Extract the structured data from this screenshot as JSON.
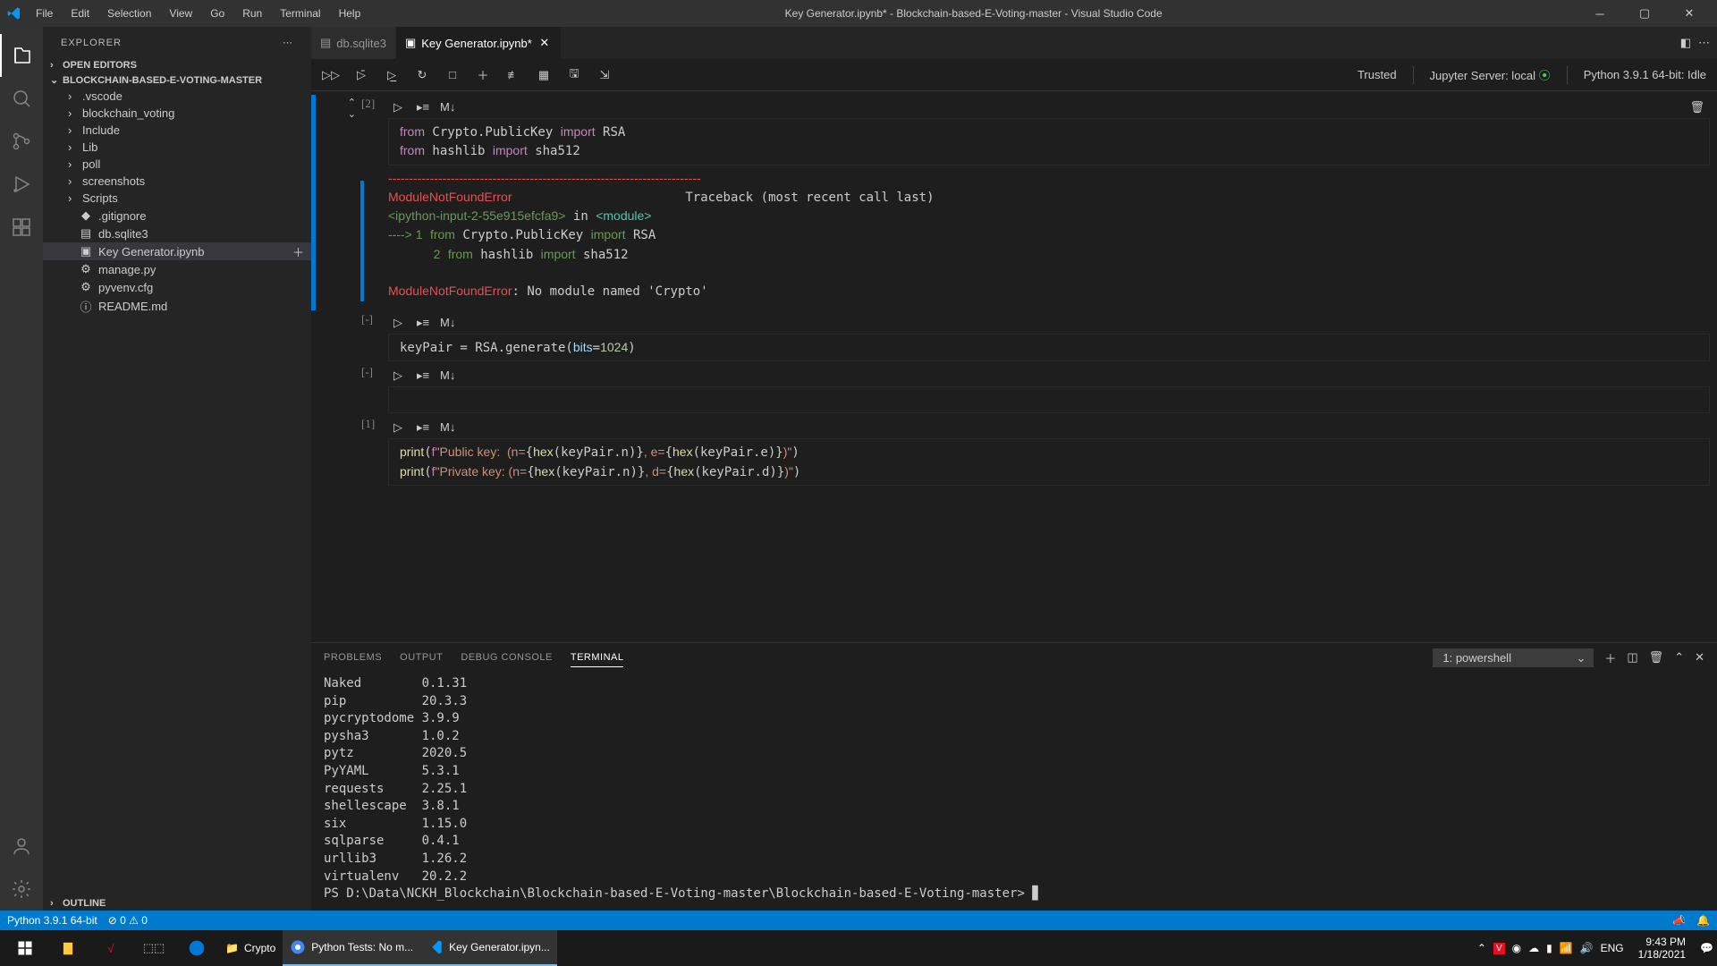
{
  "title": "Key Generator.ipynb* - Blockchain-based-E-Voting-master - Visual Studio Code",
  "menu": [
    "File",
    "Edit",
    "Selection",
    "View",
    "Go",
    "Run",
    "Terminal",
    "Help"
  ],
  "sidebar": {
    "header": "EXPLORER",
    "open_editors": "OPEN EDITORS",
    "project": "BLOCKCHAIN-BASED-E-VOTING-MASTER",
    "folders": [
      ".vscode",
      "blockchain_voting",
      "Include",
      "Lib",
      "poll",
      "screenshots",
      "Scripts"
    ],
    "files": [
      ".gitignore",
      "db.sqlite3",
      "Key Generator.ipynb",
      "manage.py",
      "pyvenv.cfg",
      "README.md"
    ],
    "outline": "OUTLINE"
  },
  "tabs": [
    {
      "label": "db.sqlite3",
      "dirty": false
    },
    {
      "label": "Key Generator.ipynb*",
      "dirty": true
    }
  ],
  "nb_right": {
    "trusted": "Trusted",
    "server": "Jupyter Server: local",
    "kernel": "Python 3.9.1 64-bit: Idle"
  },
  "cells": [
    {
      "exec": "[2]"
    },
    {
      "exec": "[-]"
    },
    {
      "exec": "[-]"
    },
    {
      "exec": "[1]"
    }
  ],
  "panel": {
    "tabs": [
      "PROBLEMS",
      "OUTPUT",
      "DEBUG CONSOLE",
      "TERMINAL"
    ],
    "select": "1: powershell",
    "packages": [
      [
        "Naked",
        "0.1.31"
      ],
      [
        "pip",
        "20.3.3"
      ],
      [
        "pycryptodome",
        "3.9.9"
      ],
      [
        "pysha3",
        "1.0.2"
      ],
      [
        "pytz",
        "2020.5"
      ],
      [
        "PyYAML",
        "5.3.1"
      ],
      [
        "requests",
        "2.25.1"
      ],
      [
        "shellescape",
        "3.8.1"
      ],
      [
        "six",
        "1.15.0"
      ],
      [
        "sqlparse",
        "0.4.1"
      ],
      [
        "urllib3",
        "1.26.2"
      ],
      [
        "virtualenv",
        "20.2.2"
      ]
    ],
    "prompt": "PS D:\\Data\\NCKH_Blockchain\\Blockchain-based-E-Voting-master\\Blockchain-based-E-Voting-master> "
  },
  "status": {
    "python": "Python 3.9.1 64-bit",
    "errors": "0",
    "warnings": "0"
  },
  "taskbar": {
    "folder": "Crypto",
    "chrome": "Python Tests: No m...",
    "vscode": "Key Generator.ipyn...",
    "lang": "ENG",
    "time": "9:43 PM",
    "date": "1/18/2021"
  }
}
